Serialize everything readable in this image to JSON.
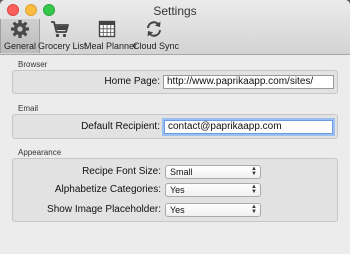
{
  "window": {
    "title": "Settings"
  },
  "toolbar": {
    "items": [
      {
        "label": "General",
        "icon": "gear-icon",
        "selected": true
      },
      {
        "label": "Grocery List",
        "icon": "shopping-cart-icon",
        "selected": false
      },
      {
        "label": "Meal Planner",
        "icon": "calendar-icon",
        "selected": false
      },
      {
        "label": "Cloud Sync",
        "icon": "sync-icon",
        "selected": false
      }
    ]
  },
  "browser": {
    "section_label": "Browser",
    "home_page_label": "Home Page:",
    "home_page_value": "http://www.paprikaapp.com/sites/"
  },
  "email": {
    "section_label": "Email",
    "recipient_label": "Default Recipient:",
    "recipient_value": "contact@paprikaapp.com"
  },
  "appearance": {
    "section_label": "Appearance",
    "font_size_label": "Recipe Font Size:",
    "font_size_value": "Small",
    "alphabetize_label": "Alphabetize Categories:",
    "alphabetize_value": "Yes",
    "placeholder_label": "Show Image Placeholder:",
    "placeholder_value": "Yes"
  },
  "colors": {
    "focus_ring": "#9cc0f3",
    "close": "#fc605c",
    "minimize": "#fdbc40",
    "maximize": "#34c84a"
  }
}
